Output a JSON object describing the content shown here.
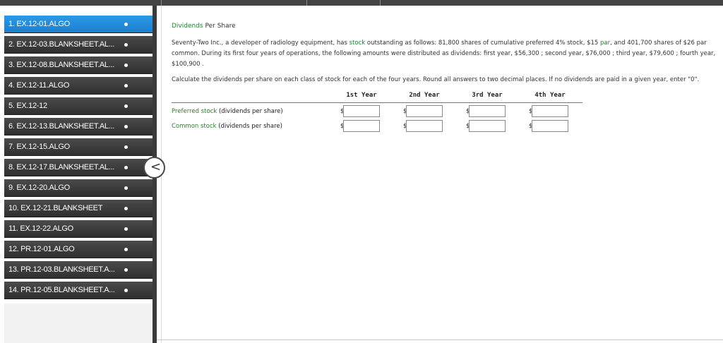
{
  "sidebar": {
    "items": [
      {
        "label": "1. EX.12-01.ALGO",
        "active": true
      },
      {
        "label": "2. EX.12-03.BLANKSHEET.AL...",
        "active": false
      },
      {
        "label": "3. EX.12-08.BLANKSHEET.AL...",
        "active": false
      },
      {
        "label": "4. EX.12-11.ALGO",
        "active": false
      },
      {
        "label": "5. EX.12-12",
        "active": false
      },
      {
        "label": "6. EX.12-13.BLANKSHEET.AL...",
        "active": false
      },
      {
        "label": "7. EX.12-15.ALGO",
        "active": false
      },
      {
        "label": "8. EX.12-17.BLANKSHEET.AL...",
        "active": false
      },
      {
        "label": "9. EX.12-20.ALGO",
        "active": false
      },
      {
        "label": "10. EX.12-21.BLANKSHEET",
        "active": false
      },
      {
        "label": "11. EX.12-22.ALGO",
        "active": false
      },
      {
        "label": "12. PR.12-01.ALGO",
        "active": false
      },
      {
        "label": "13. PR.12-03.BLANKSHEET.A...",
        "active": false
      },
      {
        "label": "14. PR.12-05.BLANKSHEET.A...",
        "active": false
      }
    ],
    "collapse_icon": "<"
  },
  "problem": {
    "title_prefix": "Dividends",
    "title_suffix": " Per Share",
    "para_1": "Seventy-Two Inc., a developer of radiology equipment, has ",
    "para_stock": "stock",
    "para_2": " outstanding as follows: 81,800 shares of cumulative preferred 4% stock, $15 ",
    "para_par": "par",
    "para_3": ", and 401,700 shares of $26 par common. During its first four years of operations, the following amounts were distributed as dividends: first year, $56,300 ; second year, $76,000 ; third year, $79,600 ; fourth year, $100,900 .",
    "instructions": "Calculate the dividends per share on each class of stock for each of the four years. Round all answers to two decimal places. If no dividends are paid in a given year, enter \"0\"."
  },
  "table": {
    "columns": [
      "1st Year",
      "2nd Year",
      "3rd Year",
      "4th Year"
    ],
    "currency": "$",
    "rows": [
      {
        "label_link": "Preferred stock",
        "label_rest": " (dividends per share)",
        "values": [
          "",
          "",
          "",
          ""
        ]
      },
      {
        "label_link": "Common stock",
        "label_rest": " (dividends per share)",
        "values": [
          "",
          "",
          "",
          ""
        ]
      }
    ]
  }
}
